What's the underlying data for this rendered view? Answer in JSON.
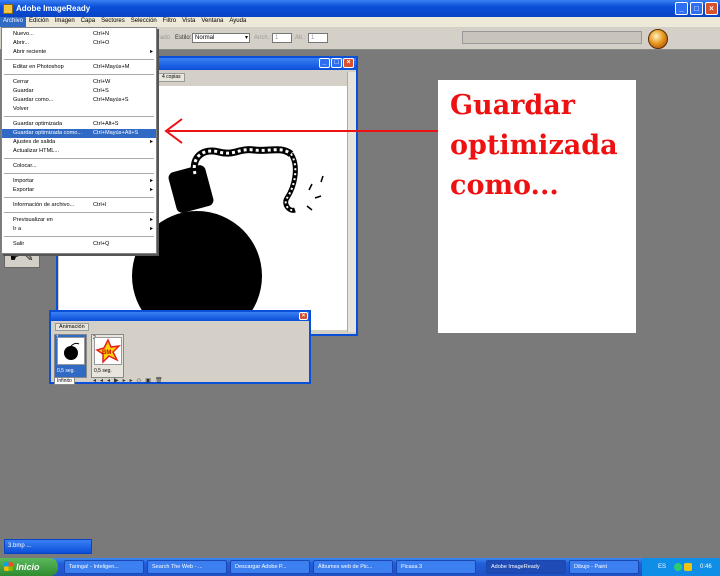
{
  "window": {
    "title": "Adobe ImageReady"
  },
  "menubar": [
    "Archivo",
    "Edición",
    "Imagen",
    "Capa",
    "Sectores",
    "Selección",
    "Filtro",
    "Vista",
    "Ventana",
    "Ayuda"
  ],
  "options": {
    "partial": "rado",
    "estilo_label": "Estilo:",
    "estilo_value": "Normal",
    "ancho_label": "Anch.:",
    "ancho_value": "1",
    "alt_label": "Alt.:",
    "alt_value": "1"
  },
  "menu": [
    {
      "label": "Nuevo...",
      "shortcut": "Ctrl+N"
    },
    {
      "label": "Abrir...",
      "shortcut": "Ctrl+O"
    },
    {
      "label": "Abrir reciente",
      "shortcut": "",
      "submenu": true
    },
    {
      "label": "Editar en Photoshop",
      "shortcut": "Ctrl+Mayús+M"
    },
    {
      "label": "Cerrar",
      "shortcut": "Ctrl+W"
    },
    {
      "label": "Guardar",
      "shortcut": "Ctrl+S"
    },
    {
      "label": "Guardar como...",
      "shortcut": "Ctrl+Mayús+S"
    },
    {
      "label": "Volver",
      "shortcut": ""
    },
    {
      "label": "Guardar optimizada",
      "shortcut": "Ctrl+Alt+S"
    },
    {
      "label": "Guardar optimizada como...",
      "shortcut": "Ctrl+Mayús+Alt+S",
      "highlighted": true
    },
    {
      "label": "Ajustes de salida",
      "shortcut": "",
      "submenu": true
    },
    {
      "label": "Actualizar HTML...",
      "shortcut": ""
    },
    {
      "label": "Colocar...",
      "shortcut": ""
    },
    {
      "label": "Importar",
      "shortcut": "",
      "submenu": true
    },
    {
      "label": "Exportar",
      "shortcut": "",
      "submenu": true
    },
    {
      "label": "Información de archivo...",
      "shortcut": "Ctrl+I"
    },
    {
      "label": "Previsualizar en",
      "shortcut": "",
      "submenu": true
    },
    {
      "label": "Ir a",
      "shortcut": "",
      "submenu": true
    },
    {
      "label": "Salir",
      "shortcut": "Ctrl+Q"
    }
  ],
  "doc": {
    "tab": "4 copias"
  },
  "animation": {
    "tab": "Animación",
    "frames": [
      {
        "num": "1",
        "delay": "0,5 seg."
      },
      {
        "num": "2",
        "delay": "0,5 seg."
      }
    ],
    "loop": "Infinito"
  },
  "annotation": {
    "lines": [
      "Guardar",
      "optimizada",
      "como..."
    ],
    "color": "#ee1111"
  },
  "minimized_doc": "3.bmp ...",
  "taskbar": {
    "start": "Inicio",
    "items": [
      "Taringa! - Inteligen...",
      "Search The Web - ...",
      "Descargar Adobe P...",
      "Álbumes web de Pic...",
      "Picasa 3",
      "Adobe ImageReady",
      "Dibujo - Paint"
    ],
    "lang": "ES",
    "clock": "0:46"
  },
  "colors": {
    "xp_blue": "#0a4fd8",
    "highlight": "#316ac5",
    "arrow": "#ee1111"
  }
}
